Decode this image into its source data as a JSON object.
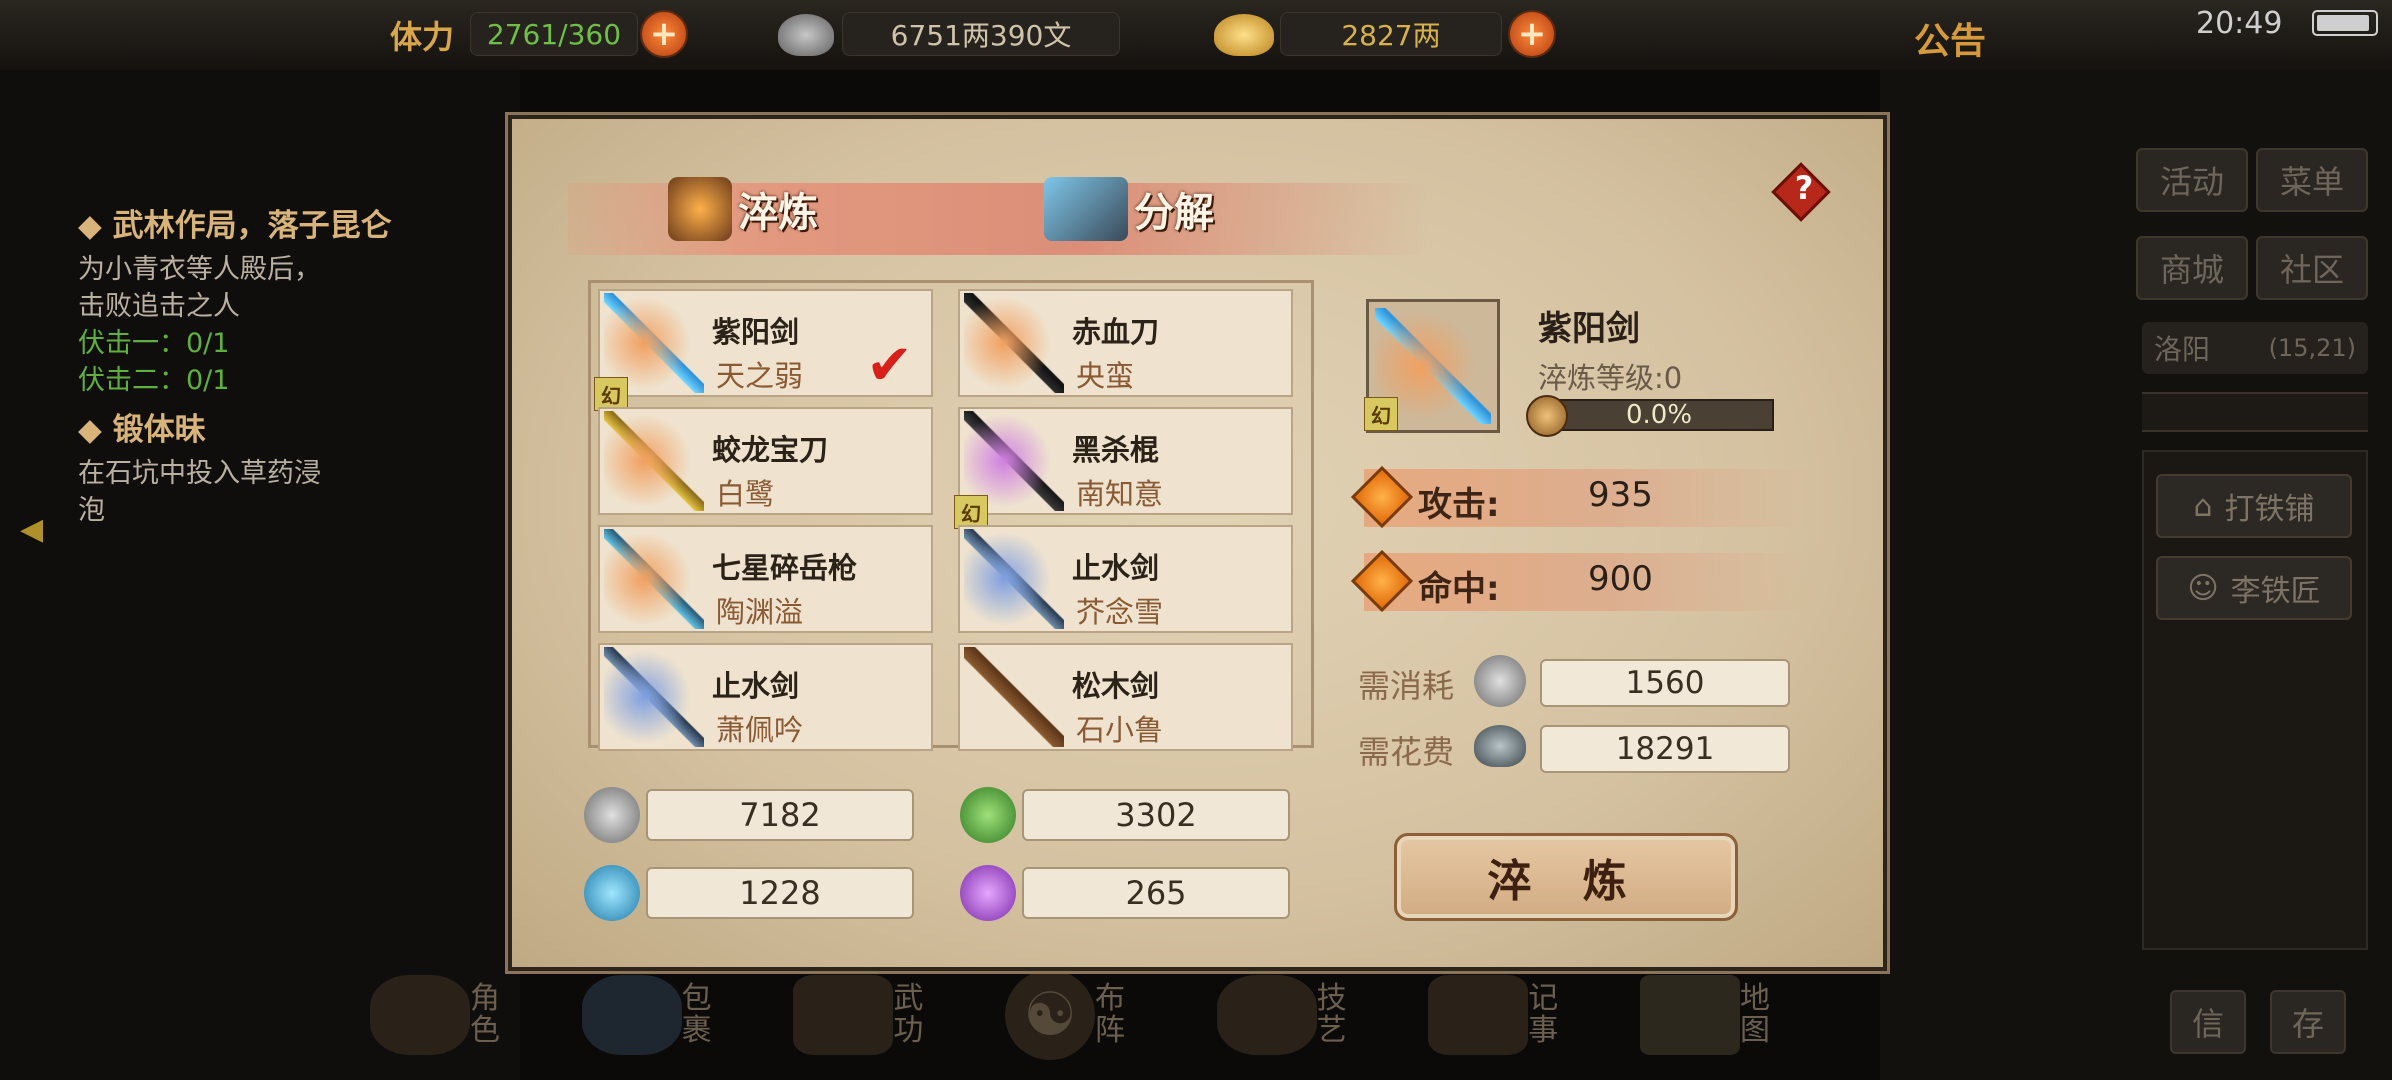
{
  "top": {
    "stamina_label": "体力",
    "stamina_value": "2761/360",
    "silver_value": "6751两390文",
    "gold_value": "2827两",
    "announcement": "公告",
    "time": "20:49"
  },
  "quests": [
    {
      "title": "武林作局，落子昆仑",
      "lines": [
        "为小青衣等人殿后，",
        "击败追击之人"
      ],
      "goals": [
        "伏击一：0/1",
        "伏击二：0/1"
      ]
    },
    {
      "title": "锻体昧",
      "lines": [
        "在石坑中投入草药浸",
        "泡"
      ],
      "goals": []
    }
  ],
  "right_menu": {
    "buttons": [
      "活动",
      "菜单",
      "商城",
      "社区"
    ],
    "location": "洛阳",
    "coords": "(15,21)",
    "npcs": [
      "打铁铺",
      "李铁匠"
    ],
    "bottom_buttons": [
      "信",
      "存"
    ]
  },
  "panel": {
    "tabs": [
      "淬炼",
      "分解"
    ],
    "help": "?",
    "items": [
      {
        "name": "紫阳剑",
        "owner": "天之弱",
        "checked": true,
        "huan": true
      },
      {
        "name": "赤血刀",
        "owner": "央蛮",
        "checked": false,
        "huan": false
      },
      {
        "name": "蛟龙宝刀",
        "owner": "白鹭",
        "checked": false,
        "huan": false
      },
      {
        "name": "黑杀棍",
        "owner": "南知意",
        "checked": false,
        "huan": true
      },
      {
        "name": "七星碎岳枪",
        "owner": "陶渊溢",
        "checked": false,
        "huan": false
      },
      {
        "name": "止水剑",
        "owner": "芥念雪",
        "checked": false,
        "huan": false
      },
      {
        "name": "止水剑",
        "owner": "萧佩吟",
        "checked": false,
        "huan": false
      },
      {
        "name": "松木剑",
        "owner": "石小鲁",
        "checked": false,
        "huan": false
      }
    ],
    "huan_label": "幻",
    "resources": [
      "7182",
      "3302",
      "1228",
      "265"
    ],
    "selected": {
      "name": "紫阳剑",
      "level_label": "淬炼等级:0",
      "progress_text": "0.0%",
      "progress": 0.0
    },
    "stats": [
      {
        "label": "攻击:",
        "value": "935"
      },
      {
        "label": "命中:",
        "value": "900"
      }
    ],
    "costs": [
      {
        "label": "需消耗",
        "value": "1560"
      },
      {
        "label": "需花费",
        "value": "18291"
      }
    ],
    "refine_button": "淬 炼"
  },
  "bottom_nav": [
    "角色",
    "包裹",
    "武功",
    "布阵",
    "技艺",
    "记事",
    "地图"
  ],
  "colors": {
    "accent_orange": "#e26a08",
    "panel_bg": "#d8c7a8",
    "tab_band": "#dc8e78"
  }
}
